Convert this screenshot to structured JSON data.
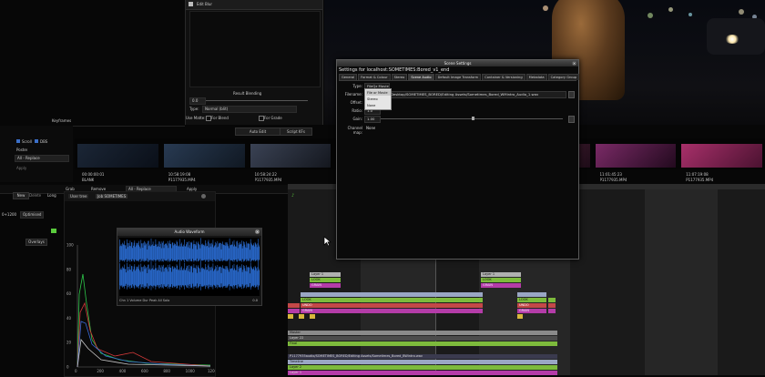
{
  "blend_panel": {
    "header_label": "Edit Blur",
    "value1": "0.0",
    "result_blending_label": "Result Blending",
    "type_label": "Type:",
    "type_value": "Normal (blit)",
    "use_matte_label": "Use Matte:",
    "for_blend_label": "For Blend",
    "for_grade_label": "For Grade",
    "value2": "0.0"
  },
  "left": {
    "keyframes_label": "Keyframes",
    "auto_edit": "Auto Edit",
    "script_kfs": "Script KFs",
    "scroll_label": "Scroll",
    "dbs_label": "DBS",
    "poster_label": "Poster",
    "replace_value": "All - Replace",
    "apply_label": "Apply"
  },
  "toolbar": {
    "grab": "Grab",
    "remove": "Remove",
    "replace": "All - Replace",
    "apply": "Apply",
    "new": "New",
    "delete": "Delete",
    "long": "Long",
    "zoom": "0+1200",
    "optimised": "Optimised",
    "overlays": "Overlays"
  },
  "graph_panel": {
    "tab_user": "User tree",
    "tab_job": "Job SOMETIMES",
    "y_ticks": [
      "100",
      "80",
      "60",
      "40",
      "20",
      "0"
    ],
    "x_ticks": [
      "0",
      "200",
      "400",
      "600",
      "800",
      "1000",
      "1200"
    ]
  },
  "audio_monitor": {
    "title": "Audio Waveform",
    "controls": "Chn 1  Volume  Dur  Peak  All  Solo",
    "level": "0.0"
  },
  "filmstrip": [
    {
      "tc": "00:00:00:01",
      "name": "BLANK",
      "colors": [
        "#1b2636",
        "#0a0f18"
      ]
    },
    {
      "tc": "10:58:19:08",
      "name": "P1177935.MP4",
      "colors": [
        "#283a52",
        "#101822"
      ]
    },
    {
      "tc": "10:58:24:22",
      "name": "P1177935.MP4",
      "colors": [
        "#3a4254",
        "#14171e"
      ]
    },
    {
      "tc": "10:58:27:03",
      "name": "P1177935.MP4",
      "colors": [
        "#3a3550",
        "#141220"
      ]
    },
    {
      "tc": "11:00:37:09",
      "name": "P1177935.MP4",
      "colors": [
        "#263040",
        "#0c1018"
      ]
    },
    {
      "tc": "11:01:32:21",
      "name": "P1177935.MP4",
      "colors": [
        "#5a2a40",
        "#1e0c18"
      ]
    },
    {
      "tc": "11:01:45:23",
      "name": "P1177935.MP4",
      "colors": [
        "#7a2a66",
        "#220a1e"
      ]
    },
    {
      "tc": "11:07:19:08",
      "name": "P1177935.MP4",
      "colors": [
        "#a8306a",
        "#4a1230"
      ]
    }
  ],
  "timeline": {
    "look": "LOOK",
    "layer": "Layer 1",
    "grain": "GRAIN",
    "undo": "UNDO",
    "master": "Master",
    "layer22": "Layer 22",
    "final": "Final",
    "path": "P1177935audio/SOMETIMES_BORED/Editing Assets/Sometimes_Bored_BWintro.wav",
    "bottom1": "Timeline",
    "bottom2": "Layer 2",
    "bottom3": "Layer 1"
  },
  "dialog": {
    "title": "Scene Settings",
    "heading": "Settings for localhost:SOMETIMES:Bored_v1_end",
    "tabs": [
      "General",
      "Format & Colour",
      "Stereo",
      "Scene Audio",
      "Default Image Transform",
      "Container & Versioning",
      "Metadata",
      "Category Group"
    ],
    "active_tab_index": 3,
    "type_label": "Type:",
    "type_value": "FileQz Movie",
    "filename_label": "Filename:",
    "filename_prefix": "None",
    "filename_value": "Desktop/SOMETIMES_BORED/Editing Assets/Sometimes_Bored_WMintro_Audio_1.wav",
    "offset_label": "Offset:",
    "offset_value": "0.0",
    "ratio_label": "Ratio:",
    "ratio_value": "1.0",
    "gain_label": "Gain:",
    "gain_value": "1.00",
    "channel_map_label": "Channel map:",
    "channel_map_value": "None",
    "popup_options": [
      "File or Movie",
      "Stereo",
      "None"
    ],
    "popup_selected_index": 0
  },
  "colors": {
    "look": "#7dba3c",
    "layer": "#8fc04c",
    "grain": "#b43ca8",
    "undo": "#c44848",
    "blue_track": "#9aa6c4",
    "waveform": "#2b6ed6"
  },
  "icons": {
    "close": "close-icon",
    "cursor": "mouse-pointer-icon"
  }
}
